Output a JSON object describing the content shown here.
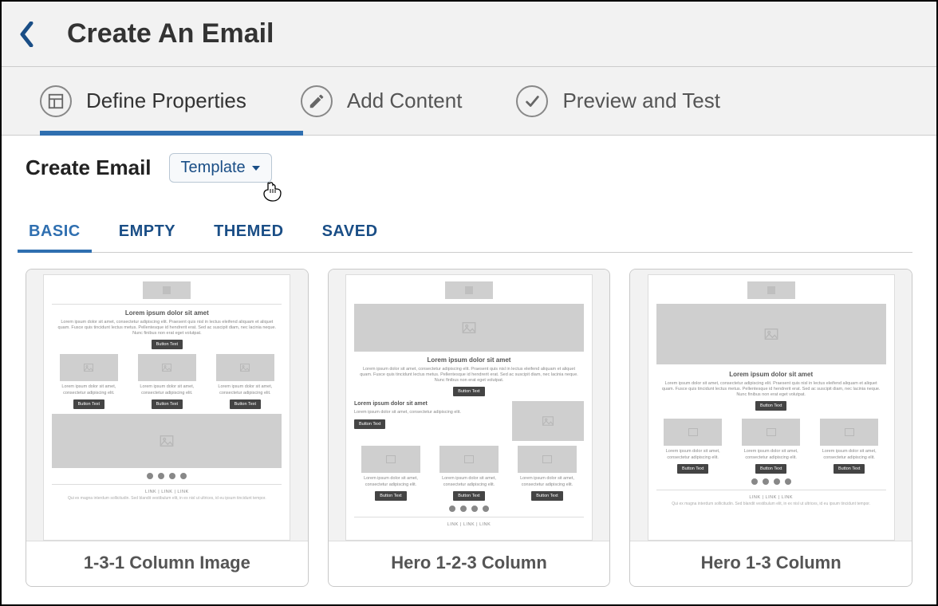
{
  "header": {
    "title": "Create An Email"
  },
  "steps": [
    {
      "label": "Define Properties",
      "active": true
    },
    {
      "label": "Add Content",
      "active": false
    },
    {
      "label": "Preview and Test",
      "active": false
    }
  ],
  "section": {
    "title": "Create Email",
    "dropdown_label": "Template"
  },
  "tabs": [
    {
      "label": "BASIC",
      "active": true
    },
    {
      "label": "EMPTY",
      "active": false
    },
    {
      "label": "THEMED",
      "active": false
    },
    {
      "label": "SAVED",
      "active": false
    }
  ],
  "templates": [
    {
      "name": "1-3-1 Column Image"
    },
    {
      "name": "Hero 1-2-3 Column"
    },
    {
      "name": "Hero 1-3 Column"
    }
  ],
  "preview_text": {
    "heading": "Lorem ipsum dolor sit amet",
    "paragraph": "Lorem ipsum dolor sit amet, consectetur adipiscing elit. Praesent quis nisl in lectus eleifend aliquam et aliquet quam. Fusce quis tincidunt lectus metus. Pellentesque id hendrerit erat. Sed ac suscipit diam, nec lacinia neque. Nunc finibus non erat eget volutpat.",
    "short": "Lorem ipsum dolor sit amet, consectetur adipiscing elit.",
    "button": "Button Text",
    "links": "LINK  |  LINK  |  LINK",
    "disclaimer": "Qui ex magna interdum sollicitudin. Sed blandit vestibulum elit, in ex nisl ut ultrices, id eu ipsum tincidunt tempor."
  }
}
